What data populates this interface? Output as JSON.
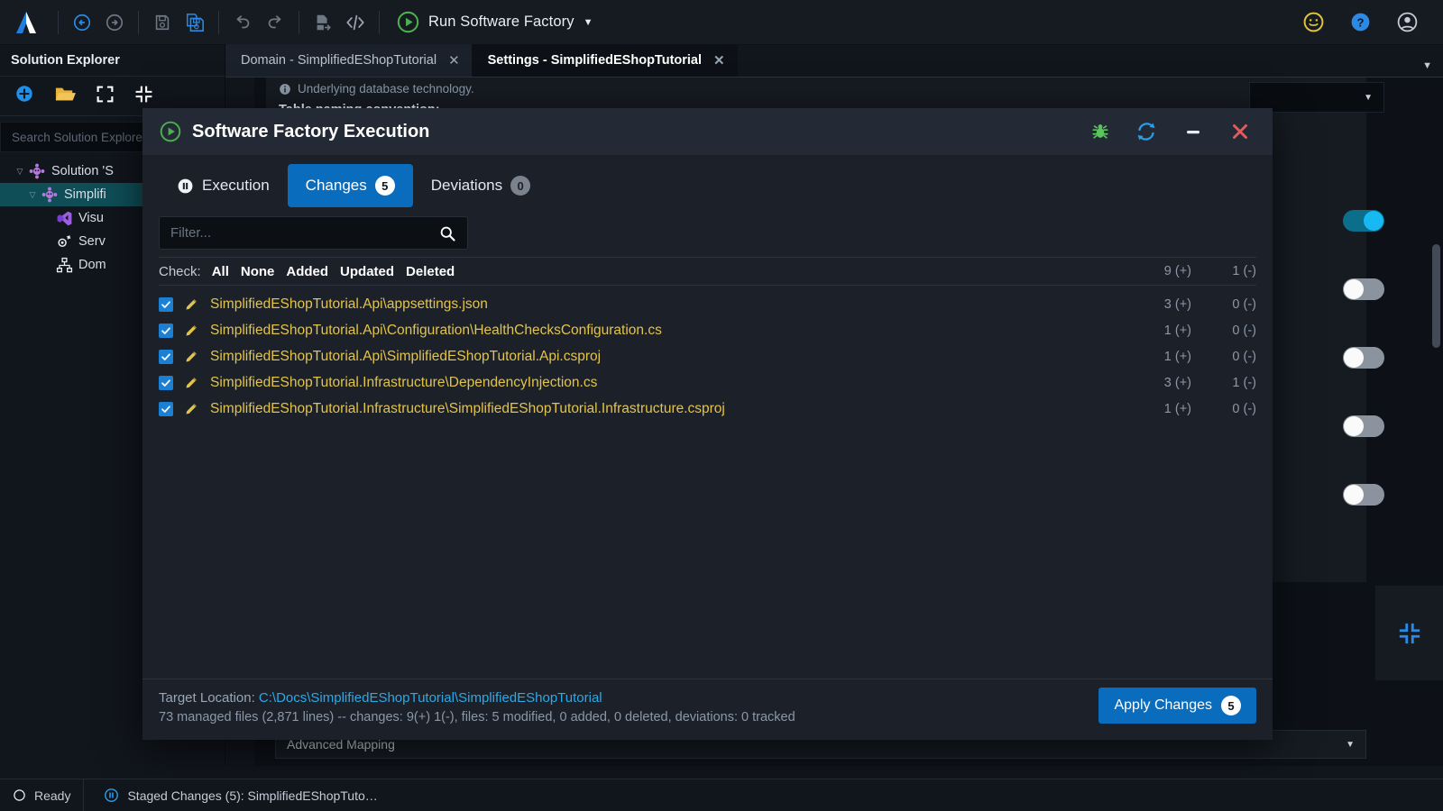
{
  "toolbar": {
    "logo_name": "avalonia-logo",
    "buttons": [
      {
        "name": "back-button",
        "icon": "arrow-left-circle-icon",
        "title": "Back"
      },
      {
        "name": "forward-button",
        "icon": "arrow-right-circle-icon",
        "title": "Forward"
      },
      {
        "name": "save-button",
        "icon": "save-icon",
        "title": "Save"
      },
      {
        "name": "save-all-button",
        "icon": "save-all-icon",
        "title": "Save All"
      },
      {
        "name": "undo-button",
        "icon": "undo-icon",
        "title": "Undo"
      },
      {
        "name": "redo-button",
        "icon": "redo-icon",
        "title": "Redo"
      },
      {
        "name": "export-button",
        "icon": "file-export-icon",
        "title": "Export"
      },
      {
        "name": "code-button",
        "icon": "code-brackets-icon",
        "title": "Code"
      }
    ],
    "run_label": "Run Software Factory",
    "run_caret": "▼",
    "right_icons": [
      {
        "name": "feedback-smiley-icon"
      },
      {
        "name": "help-icon"
      },
      {
        "name": "account-icon"
      }
    ]
  },
  "sidebar": {
    "title": "Solution Explorer",
    "tools": [
      {
        "name": "add-icon"
      },
      {
        "name": "open-folder-icon"
      },
      {
        "name": "expand-all-icon"
      },
      {
        "name": "collapse-all-icon"
      }
    ],
    "search_placeholder": "Search Solution Explorer",
    "tree": [
      {
        "label": "Solution 'S",
        "icon": "solution-icon",
        "twisty": "▽",
        "indent": 0,
        "selected": false
      },
      {
        "label": "Simplifi",
        "icon": "project-icon",
        "twisty": "▽",
        "indent": 1,
        "selected": true
      },
      {
        "label": "Visu",
        "icon": "visual-studio-icon",
        "twisty": "",
        "indent": 2,
        "selected": false
      },
      {
        "label": "Serv",
        "icon": "services-icon",
        "twisty": "",
        "indent": 2,
        "selected": false
      },
      {
        "label": "Dom",
        "icon": "domain-icon",
        "twisty": "",
        "indent": 2,
        "selected": false
      }
    ]
  },
  "editor": {
    "tabs": [
      {
        "label": "Domain - SimplifiedEShopTutorial",
        "close": "✕",
        "active": false
      },
      {
        "label": "Settings - SimplifiedEShopTutorial",
        "close": "✕",
        "active": true
      }
    ],
    "overflow_caret": "▼",
    "hint_text": "Underlying database technology.",
    "heading_text": "Table naming convention:",
    "advanced_mapping_label": "Advanced Mapping",
    "select_caret": "▼",
    "toggles": [
      {
        "name": "toggle-1",
        "on": true
      },
      {
        "name": "toggle-2",
        "on": false
      },
      {
        "name": "toggle-3",
        "on": false
      },
      {
        "name": "toggle-4",
        "on": false
      },
      {
        "name": "toggle-5",
        "on": false
      }
    ]
  },
  "dialog": {
    "title": "Software Factory Execution",
    "title_icon": "play-circle-icon",
    "title_buttons": [
      {
        "name": "debug-bug-icon"
      },
      {
        "name": "refresh-icon"
      },
      {
        "name": "minimize-icon"
      },
      {
        "name": "close-icon"
      }
    ],
    "tabs": [
      {
        "label": "Execution",
        "badge": null,
        "icon": "pause-circle-icon",
        "active": false
      },
      {
        "label": "Changes",
        "badge": "5",
        "icon": null,
        "active": true
      },
      {
        "label": "Deviations",
        "badge": "0",
        "icon": null,
        "active": false
      }
    ],
    "filter_placeholder": "Filter...",
    "filter_value": "",
    "search_icon": "search-icon",
    "check": {
      "label": "Check:",
      "options": [
        "All",
        "None",
        "Added",
        "Updated",
        "Deleted"
      ],
      "total_added": "9 (+)",
      "total_removed": "1 (-)"
    },
    "files": [
      {
        "checked": true,
        "icon": "pencil-icon",
        "name": "SimplifiedEShopTutorial.Api\\appsettings.json",
        "added": "3 (+)",
        "removed": "0 (-)"
      },
      {
        "checked": true,
        "icon": "pencil-icon",
        "name": "SimplifiedEShopTutorial.Api\\Configuration\\HealthChecksConfiguration.cs",
        "added": "1 (+)",
        "removed": "0 (-)"
      },
      {
        "checked": true,
        "icon": "pencil-icon",
        "name": "SimplifiedEShopTutorial.Api\\SimplifiedEShopTutorial.Api.csproj",
        "added": "1 (+)",
        "removed": "0 (-)"
      },
      {
        "checked": true,
        "icon": "pencil-icon",
        "name": "SimplifiedEShopTutorial.Infrastructure\\DependencyInjection.cs",
        "added": "3 (+)",
        "removed": "1 (-)"
      },
      {
        "checked": true,
        "icon": "pencil-icon",
        "name": "SimplifiedEShopTutorial.Infrastructure\\SimplifiedEShopTutorial.Infrastructure.csproj",
        "added": "1 (+)",
        "removed": "0 (-)"
      }
    ],
    "footer": {
      "target_label": "Target Location: ",
      "target_path": "C:\\Docs\\SimplifiedEShopTutorial\\SimplifiedEShopTutorial",
      "stats": "73 managed files (2,871 lines) -- changes: 9(+) 1(-), files: 5 modified, 0 added, 0 deleted, deviations: 0 tracked",
      "apply_label": "Apply Changes",
      "apply_badge": "5"
    }
  },
  "statusbar": {
    "ready_label": "Ready",
    "ready_icon": "circle-icon",
    "staged_icon": "pause-circle-icon",
    "staged_label": "Staged Changes (5): SimplifiedEShopTuto…"
  },
  "colors": {
    "accent_blue": "#0a6cbd",
    "file_yellow": "#e3c44a",
    "link_blue": "#2ea8e6",
    "green": "#4caf50",
    "close_red": "#e05c5c",
    "toggle_on": "#17b9f3"
  }
}
